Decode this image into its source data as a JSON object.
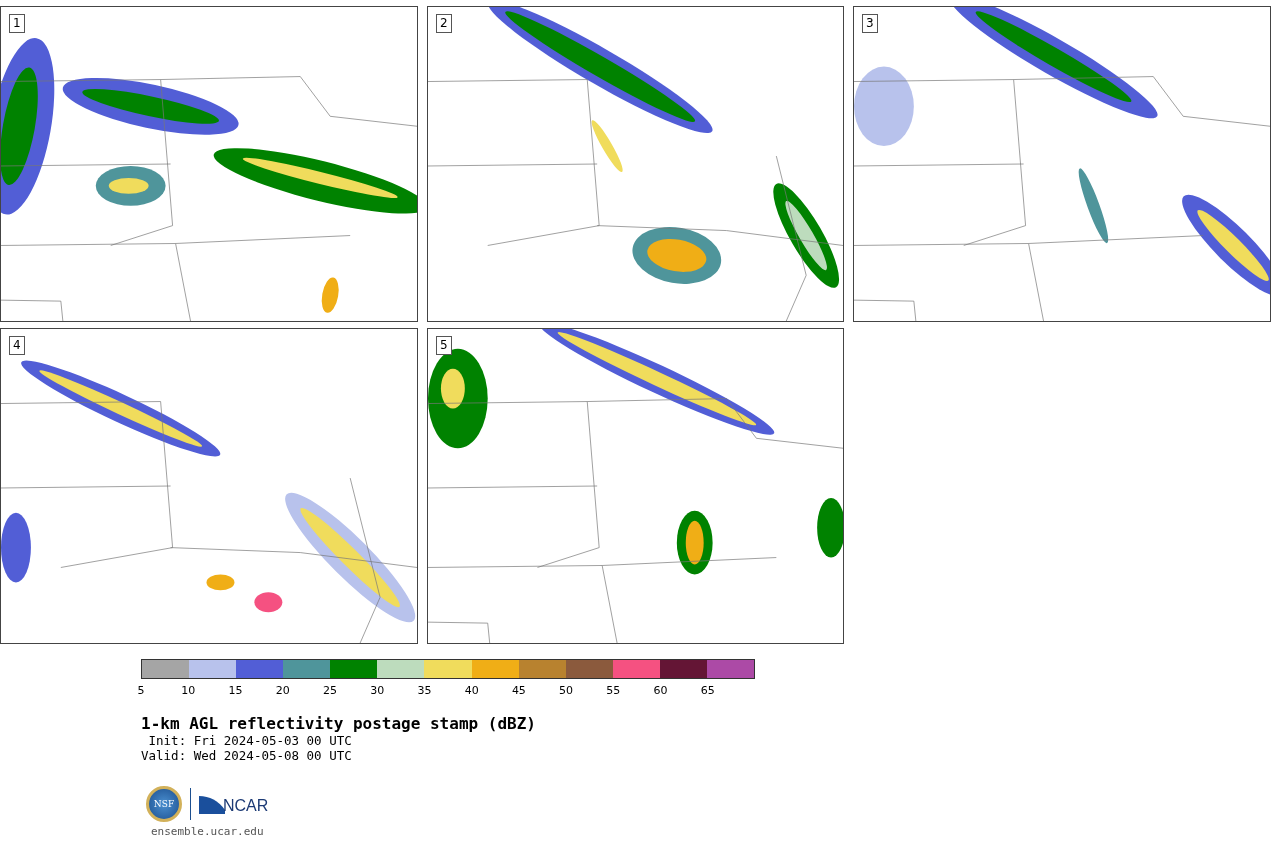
{
  "panels": [
    {
      "number": "1"
    },
    {
      "number": "2"
    },
    {
      "number": "3"
    },
    {
      "number": "4"
    },
    {
      "number": "5"
    }
  ],
  "colorbar": {
    "bins": [
      {
        "color": "#a5a5a5"
      },
      {
        "color": "#b8c2ec"
      },
      {
        "color": "#525ed6"
      },
      {
        "color": "#4f959b"
      },
      {
        "color": "#008200"
      },
      {
        "color": "#bddcbd"
      },
      {
        "color": "#f0dc5c"
      },
      {
        "color": "#f0ae16"
      },
      {
        "color": "#b8822f"
      },
      {
        "color": "#8b5a3d"
      },
      {
        "color": "#f55181"
      },
      {
        "color": "#641535"
      },
      {
        "color": "#ac4aa6"
      }
    ],
    "ticks": [
      "5",
      "10",
      "15",
      "20",
      "25",
      "30",
      "35",
      "40",
      "45",
      "50",
      "55",
      "60",
      "65"
    ]
  },
  "title": "1-km AGL reflectivity postage stamp (dBZ)",
  "init": " Init: Fri 2024-05-03 00 UTC",
  "valid": "Valid: Wed 2024-05-08 00 UTC",
  "logo": {
    "seal": "NSF",
    "brand": "NCAR"
  },
  "footer": "ensemble.ucar.edu"
}
